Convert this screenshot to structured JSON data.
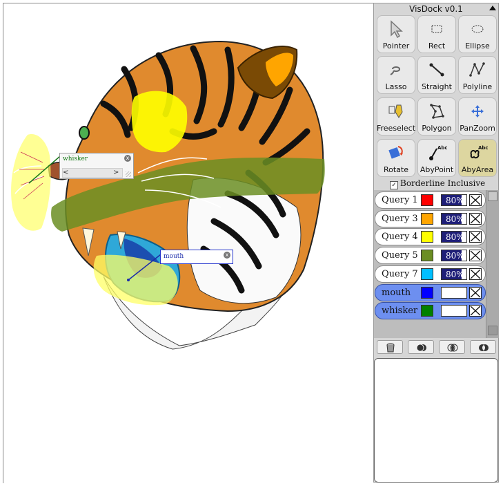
{
  "dock": {
    "title": "VisDock v0.1",
    "tools": [
      {
        "label": "Pointer",
        "icon": "pointer-icon",
        "active": false
      },
      {
        "label": "Rect",
        "icon": "rect-select-icon",
        "active": false
      },
      {
        "label": "Ellipse",
        "icon": "ellipse-select-icon",
        "active": false
      },
      {
        "label": "Lasso",
        "icon": "lasso-icon",
        "active": false
      },
      {
        "label": "Straight",
        "icon": "straight-line-icon",
        "active": false
      },
      {
        "label": "Polyline",
        "icon": "polyline-icon",
        "active": false
      },
      {
        "label": "Freeselect",
        "icon": "freeselect-icon",
        "active": false
      },
      {
        "label": "Polygon",
        "icon": "polygon-icon",
        "active": false
      },
      {
        "label": "PanZoom",
        "icon": "panzoom-icon",
        "active": false
      },
      {
        "label": "Rotate",
        "icon": "rotate-icon",
        "active": false
      },
      {
        "label": "AbyPoint",
        "icon": "annotate-by-point-icon",
        "active": false
      },
      {
        "label": "AbyArea",
        "icon": "annotate-by-area-icon",
        "active": true
      }
    ],
    "annotation_icon_text": "Abc",
    "borderline_label": "Borderline Inclusive",
    "borderline_checked": true,
    "queries": [
      {
        "name": "Query 1",
        "color": "#ff0000",
        "opacity": "80%",
        "opacity_value": 0.8,
        "selected": false
      },
      {
        "name": "Query 3",
        "color": "#ffa500",
        "opacity": "80%",
        "opacity_value": 0.8,
        "selected": false
      },
      {
        "name": "Query 4",
        "color": "#ffff00",
        "opacity": "80%",
        "opacity_value": 0.8,
        "selected": false
      },
      {
        "name": "Query 5",
        "color": "#6b8e23",
        "opacity": "80%",
        "opacity_value": 0.8,
        "selected": false
      },
      {
        "name": "Query 7",
        "color": "#00bfff",
        "opacity": "80%",
        "opacity_value": 0.8,
        "selected": false
      },
      {
        "name": "mouth",
        "color": "#0000ff",
        "opacity": "",
        "opacity_value": 0,
        "selected": true
      },
      {
        "name": "whisker",
        "color": "#008000",
        "opacity": "",
        "opacity_value": 0,
        "selected": true
      }
    ],
    "set_operations": [
      {
        "icon": "trash-icon"
      },
      {
        "icon": "union-icon"
      },
      {
        "icon": "intersection-icon"
      },
      {
        "icon": "xor-icon"
      }
    ]
  },
  "annotations": [
    {
      "id": "whisker",
      "label": "whisker",
      "color": "#1a7a1a",
      "close": "x",
      "nav_prev": "<",
      "nav_next": ">"
    },
    {
      "id": "mouth",
      "label": "mouth",
      "color": "#1a2aaa",
      "close": "x"
    }
  ],
  "colors": {
    "dock_bg": "#d6d6d6",
    "active_tool": "#ddd6a0",
    "selected_query": "#6d8ff0",
    "opacity_fill": "#1e1e78"
  }
}
